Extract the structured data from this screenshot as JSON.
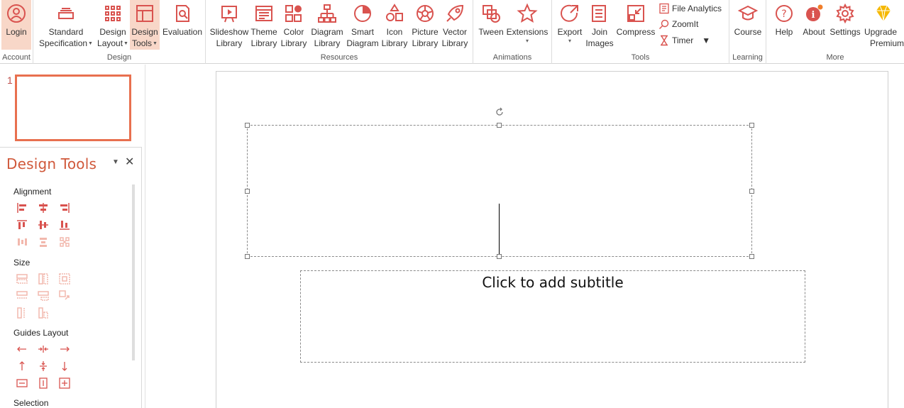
{
  "ribbon": {
    "groups": {
      "account": "Account",
      "design": "Design",
      "resources": "Resources",
      "animations": "Animations",
      "tools": "Tools",
      "learning": "Learning",
      "more": "More"
    },
    "buttons": {
      "login": "Login",
      "standard_line1": "Standard",
      "standard_line2": "Specification",
      "design_layout_line1": "Design",
      "design_layout_line2": "Layout",
      "design_tools_line1": "Design",
      "design_tools_line2": "Tools",
      "evaluation": "Evaluation",
      "slideshow_line1": "Slideshow",
      "slideshow_line2": "Library",
      "theme_line1": "Theme",
      "theme_line2": "Library",
      "color_line1": "Color",
      "color_line2": "Library",
      "diagram_line1": "Diagram",
      "diagram_line2": "Library",
      "smart_line1": "Smart",
      "smart_line2": "Diagram",
      "icon_line1": "Icon",
      "icon_line2": "Library",
      "picture_line1": "Picture",
      "picture_line2": "Library",
      "vector_line1": "Vector",
      "vector_line2": "Library",
      "tween": "Tween",
      "extensions": "Extensions",
      "export": "Export",
      "join_line1": "Join",
      "join_line2": "Images",
      "compress": "Compress",
      "file_analytics": "File Analytics",
      "zoomit": "ZoomIt",
      "timer": "Timer",
      "course": "Course",
      "help": "Help",
      "about": "About",
      "settings": "Settings",
      "upgrade_line1": "Upgrade",
      "upgrade_line2": "Premium"
    }
  },
  "thumbnails": {
    "slide_number": "1"
  },
  "design_panel": {
    "title": "Design Tools",
    "sections": {
      "alignment": "Alignment",
      "size": "Size",
      "guides": "Guides Layout",
      "selection": "Selection"
    }
  },
  "slide": {
    "subtitle_placeholder": "Click to add subtitle"
  },
  "colors": {
    "accent": "#d0593b",
    "active_bg": "#f8d7c8",
    "icon": "#d9534f"
  }
}
